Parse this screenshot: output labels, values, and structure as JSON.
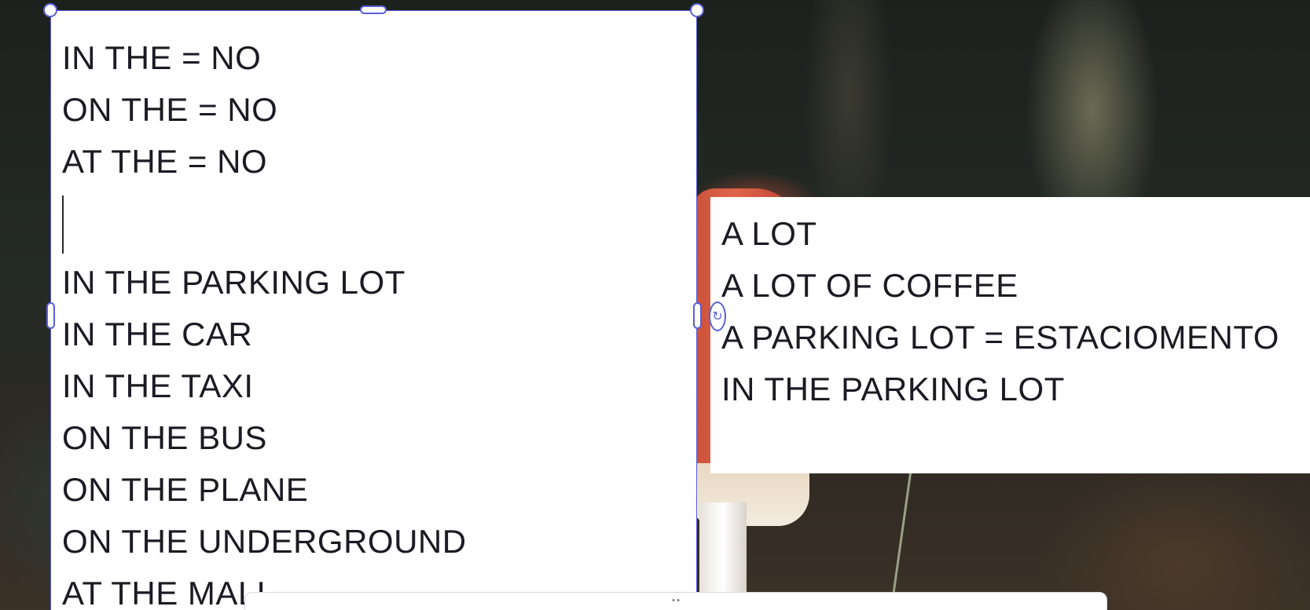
{
  "canvas": {
    "background": "forest-mushroom-photo",
    "accent_color": "#5b5fd8"
  },
  "left_textbox": {
    "lines_top": [
      "IN THE = NO",
      "ON THE = NO",
      "AT THE = NO"
    ],
    "lines_bottom": [
      "IN THE PARKING LOT",
      "IN THE CAR",
      "IN THE TAXI",
      "ON THE BUS",
      "ON THE PLANE",
      "ON THE UNDERGROUND",
      "AT THE MALL"
    ]
  },
  "right_textbox": {
    "lines": [
      "A LOT",
      "A LOT OF COFFEE",
      "A PARKING LOT = ESTACIOMENTO",
      "IN THE PARKING LOT"
    ]
  },
  "selection": {
    "handles": [
      "top-left",
      "top-mid",
      "top-right",
      "side-left",
      "side-right"
    ],
    "rotate_icon": "rotate-icon"
  },
  "toolbar": {
    "grip_icon": "drag-grip-icon"
  }
}
